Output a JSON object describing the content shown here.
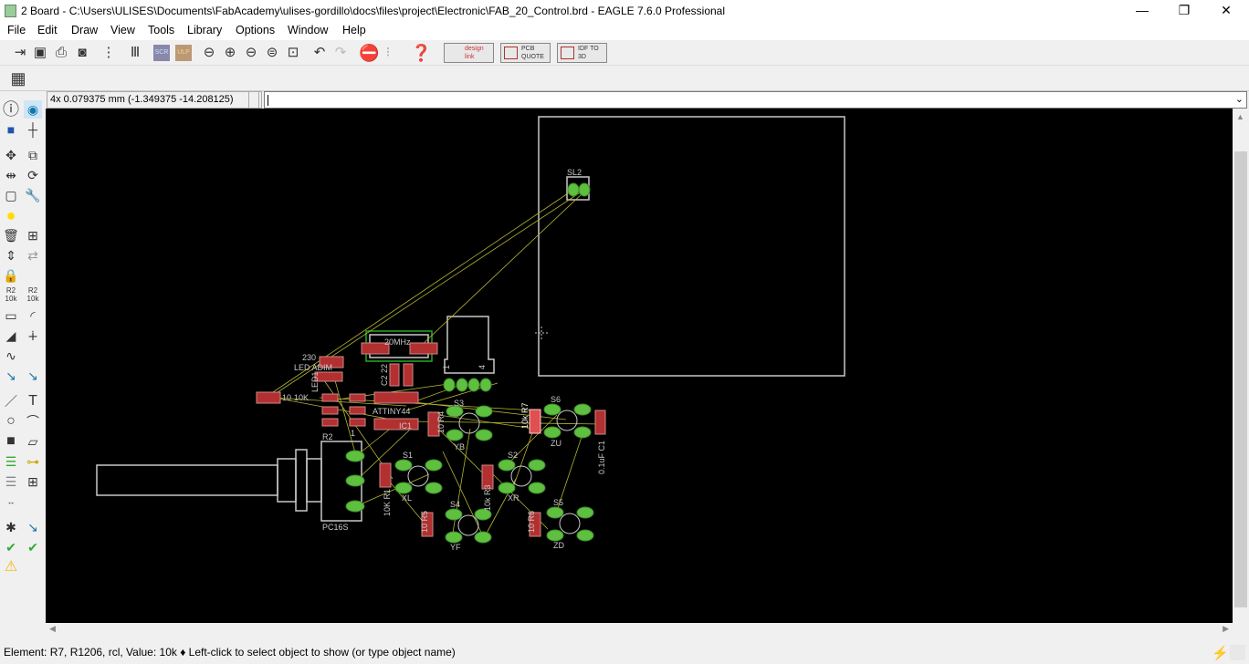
{
  "window": {
    "title": "2 Board - C:\\Users\\ULISES\\Documents\\FabAcademy\\ulises-gordillo\\docs\\files\\project\\Electronic\\FAB_20_Control.brd - EAGLE 7.6.0 Professional",
    "minimize": "—",
    "maximize": "❐",
    "close": "✕"
  },
  "menu": [
    "File",
    "Edit",
    "Draw",
    "View",
    "Tools",
    "Library",
    "Options",
    "Window",
    "Help"
  ],
  "toolbar": {
    "designlink": "design link",
    "pcbquote": "PCB QUOTE",
    "idf": "IDF TO 3D"
  },
  "coord_display": "4x 0.079375 mm (-1.349375 -14.208125)",
  "command_input": "",
  "board": {
    "labels": {
      "sl2": "SL2",
      "led_adim": "LED ADIM",
      "r230": "230",
      "led1": "LED1",
      "r10": "10",
      "r10k": "10K",
      "attiny": "ATTINY44",
      "ic1": "IC1",
      "one": "1",
      "r2": "R2",
      "pc16s": "PC16S",
      "c2": "C2 22",
      "mhz": "20MHz",
      "s1": "S1",
      "s2": "S2",
      "s3": "S3",
      "s4": "S4",
      "s5": "S5",
      "s6": "S6",
      "xl": "XL",
      "xr": "XR",
      "yb": "YB",
      "yf": "YF",
      "zu": "ZU",
      "zd": "ZD",
      "r1": "10K R1",
      "r3": "10k R3",
      "r4": "10 R4",
      "r5": "10 R5",
      "r6": "10 R6",
      "r7": "10k R7",
      "c1": "0.1uF C1",
      "ftdi1": "1",
      "ftdi4": "4"
    }
  },
  "status": "Element: R7, R1206, rcl, Value: 10k ♦ Left-click to select object to show (or type object name)",
  "colors": {
    "canvas": "#000000",
    "pad": "#5fbf3f",
    "smd": "#b33030",
    "silk": "#c8c8c8",
    "airwire": "#b4b432"
  }
}
